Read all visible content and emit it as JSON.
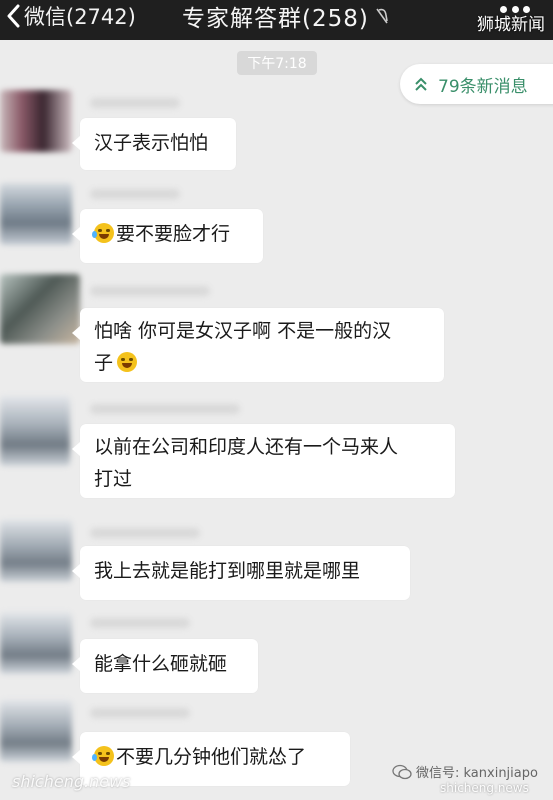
{
  "header": {
    "back_label": "微信(2742)",
    "title": "专家解答群(258)",
    "brand": "狮城新闻"
  },
  "time_label": "下午7:18",
  "new_messages": "79条新消息",
  "messages": [
    {
      "text": "汉子表示怕怕"
    },
    {
      "text": "要不要脸才行",
      "emoji": "laugh-cry-emoji"
    },
    {
      "line1": "怕啥 你可是女汉子啊 不是一般的汉",
      "line2": "子",
      "emoji": "grin-emoji"
    },
    {
      "line1": "以前在公司和印度人还有一个马来人",
      "line2": "打过"
    },
    {
      "text": "我上去就是能打到哪里就是哪里"
    },
    {
      "text": "能拿什么砸就砸"
    },
    {
      "text": "不要几分钟他们就怂了",
      "emoji": "laugh-cry-emoji"
    }
  ],
  "watermark": {
    "left": "shicheng.news",
    "right_line1": "微信号: kanxinjiapo",
    "right_line2": "shicheng.news"
  },
  "colors": {
    "topbar": "#1f1f1f",
    "background": "#ececec",
    "bubble": "#ffffff",
    "new_messages_text": "#3a8f6a"
  }
}
